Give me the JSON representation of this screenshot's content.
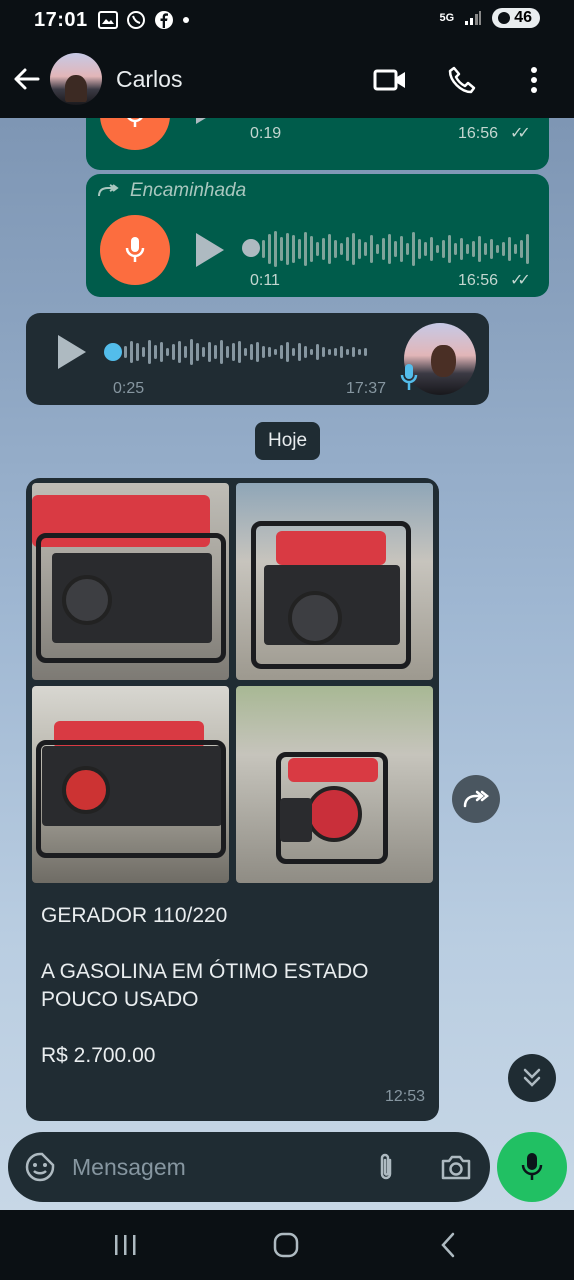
{
  "status_bar": {
    "time": "17:01",
    "network": "5G",
    "battery": "46"
  },
  "header": {
    "contact_name": "Carlos"
  },
  "messages": {
    "voice_out_1": {
      "duration": "0:19",
      "time": "16:56"
    },
    "voice_out_2": {
      "forward_label": "Encaminhada",
      "duration": "0:11",
      "time": "16:56"
    },
    "voice_in": {
      "duration": "0:25",
      "time": "17:37"
    },
    "date_chip": "Hoje",
    "photo_message": {
      "title": "GERADOR 110/220",
      "description": "A GASOLINA EM ÓTIMO ESTADO\nPOUCO USADO",
      "price": "R$ 2.700.00",
      "time": "12:53"
    }
  },
  "composer": {
    "placeholder": "Mensagem"
  }
}
